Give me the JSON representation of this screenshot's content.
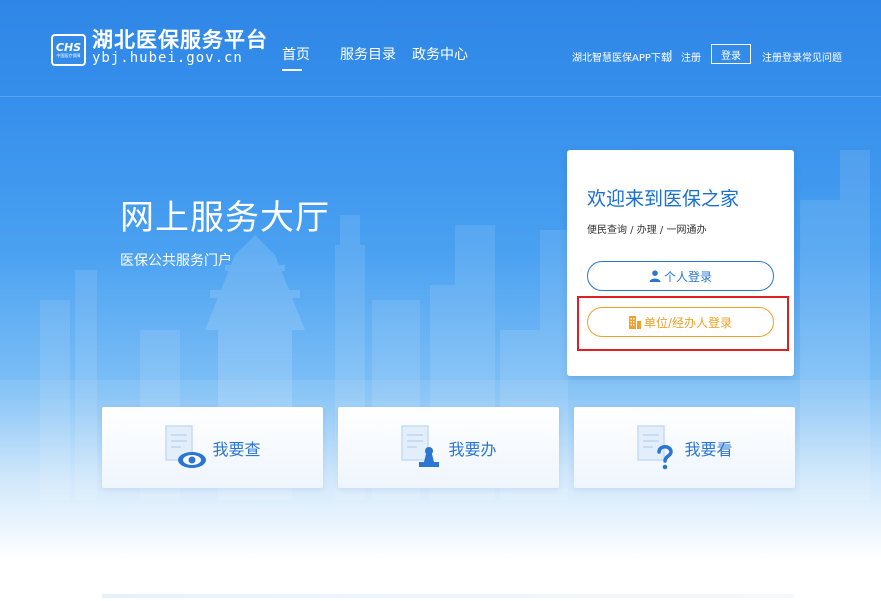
{
  "header": {
    "logo_text": "CHS",
    "logo_subtext": "中国医疗保障",
    "site_title": "湖北医保服务平台",
    "site_domain": "ybj.hubei.gov.cn",
    "nav": [
      {
        "label": "首页",
        "active": true
      },
      {
        "label": "服务目录",
        "active": false
      },
      {
        "label": "政务中心",
        "active": false
      }
    ],
    "app_download": "湖北智慧医保APP下载",
    "separator": "|",
    "register": "注册",
    "login": "登录",
    "register_faq": "注册登录常见问题"
  },
  "hero": {
    "title": "网上服务大厅",
    "subtitle": "医保公共服务门户"
  },
  "login_card": {
    "welcome": "欢迎来到医保之家",
    "tagline": "便民查询 / 办理 / 一网通办",
    "personal_login": "个人登录",
    "unit_login": "单位/经办人登录"
  },
  "services": [
    {
      "label": "我要查",
      "icon": "document-eye-icon"
    },
    {
      "label": "我要办",
      "icon": "document-stamp-icon"
    },
    {
      "label": "我要看",
      "icon": "document-question-icon"
    }
  ],
  "colors": {
    "primary_blue": "#2a76d2",
    "hero_blue": "#2f86e6",
    "accent_orange": "#f0a12a",
    "highlight_red": "#e02020"
  }
}
